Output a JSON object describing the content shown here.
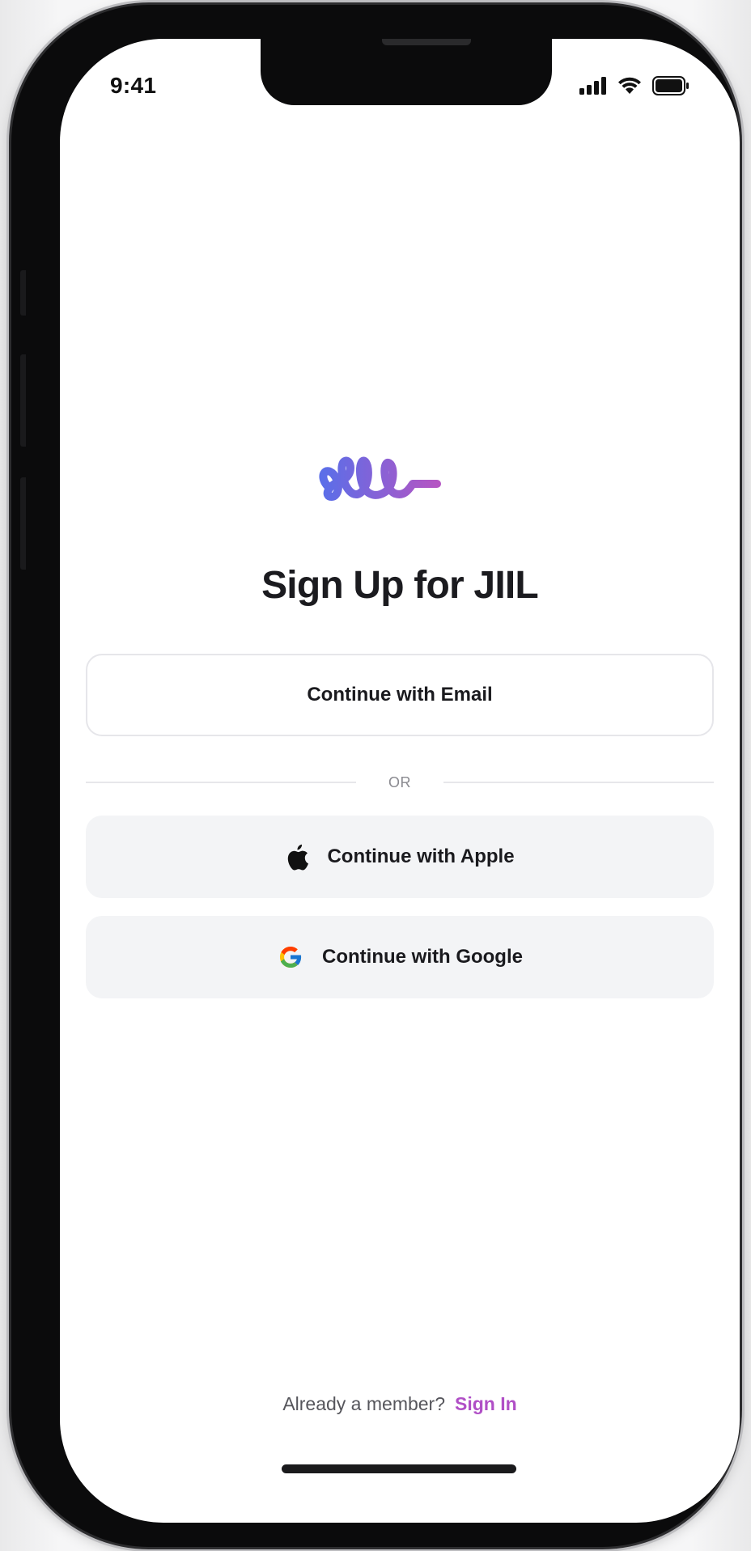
{
  "status_bar": {
    "time": "9:41"
  },
  "logo": {
    "icon": "jiil-logo-icon",
    "gradient_start": "#5b6ee8",
    "gradient_end": "#b455c3"
  },
  "title": "Sign Up for JIIL",
  "buttons": {
    "email_label": "Continue with Email",
    "apple_label": "Continue with Apple",
    "google_label": "Continue with Google"
  },
  "divider": {
    "label": "OR"
  },
  "footer": {
    "prompt": "Already a member?",
    "link_label": "Sign In",
    "link_color": "#b04fc6"
  }
}
